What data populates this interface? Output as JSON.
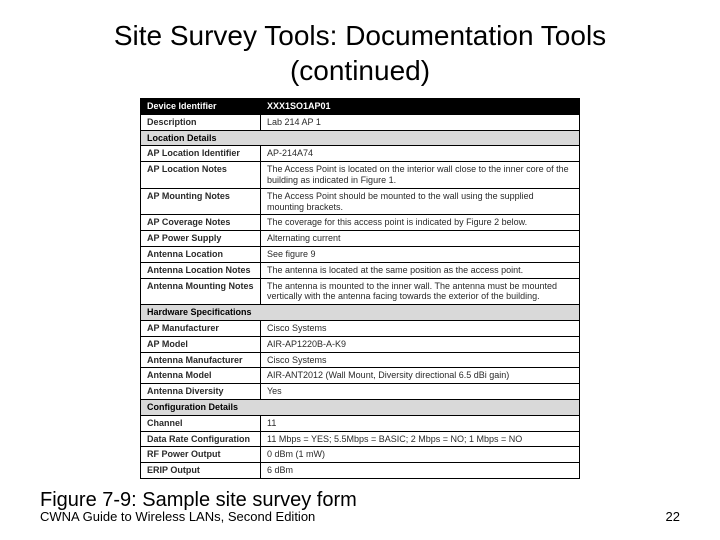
{
  "title": "Site Survey Tools: Documentation Tools (continued)",
  "caption": "Figure 7-9: Sample site survey form",
  "footer_left": "CWNA Guide to Wireless LANs, Second Edition",
  "footer_right": "22",
  "form": {
    "header": {
      "label": "Device Identifier",
      "value": "XXX1SO1AP01"
    },
    "rows1": [
      {
        "label": "Description",
        "value": "Lab 214 AP 1"
      }
    ],
    "section1": "Location Details",
    "rows2": [
      {
        "label": "AP Location Identifier",
        "value": "AP-214A74"
      },
      {
        "label": "AP Location Notes",
        "value": "The Access Point is located on the interior wall close to the inner core of the building as indicated in Figure 1."
      },
      {
        "label": "AP Mounting Notes",
        "value": "The Access Point should be mounted to the wall using the supplied mounting brackets."
      },
      {
        "label": "AP Coverage Notes",
        "value": "The coverage for this access point is indicated by Figure 2 below."
      },
      {
        "label": "AP Power Supply",
        "value": "Alternating current"
      },
      {
        "label": "Antenna Location",
        "value": "See figure 9"
      },
      {
        "label": "Antenna Location Notes",
        "value": "The antenna is located at the same position as the access point."
      },
      {
        "label": "Antenna Mounting Notes",
        "value": "The antenna is mounted to the inner wall. The antenna must be mounted vertically with the antenna facing towards the exterior of the building."
      }
    ],
    "section2": "Hardware Specifications",
    "rows3": [
      {
        "label": "AP Manufacturer",
        "value": "Cisco Systems"
      },
      {
        "label": "AP Model",
        "value": "AIR-AP1220B-A-K9"
      },
      {
        "label": "Antenna Manufacturer",
        "value": "Cisco Systems"
      },
      {
        "label": "Antenna Model",
        "value": "AIR-ANT2012 (Wall Mount, Diversity directional 6.5 dBi gain)"
      },
      {
        "label": "Antenna Diversity",
        "value": "Yes"
      }
    ],
    "section3": "Configuration Details",
    "rows4": [
      {
        "label": "Channel",
        "value": "11"
      },
      {
        "label": "Data Rate Configuration",
        "value": "11 Mbps = YES; 5.5Mbps = BASIC; 2 Mbps = NO; 1 Mbps = NO"
      },
      {
        "label": "RF Power Output",
        "value": "0 dBm (1 mW)"
      },
      {
        "label": "ERIP Output",
        "value": "6 dBm"
      }
    ]
  }
}
